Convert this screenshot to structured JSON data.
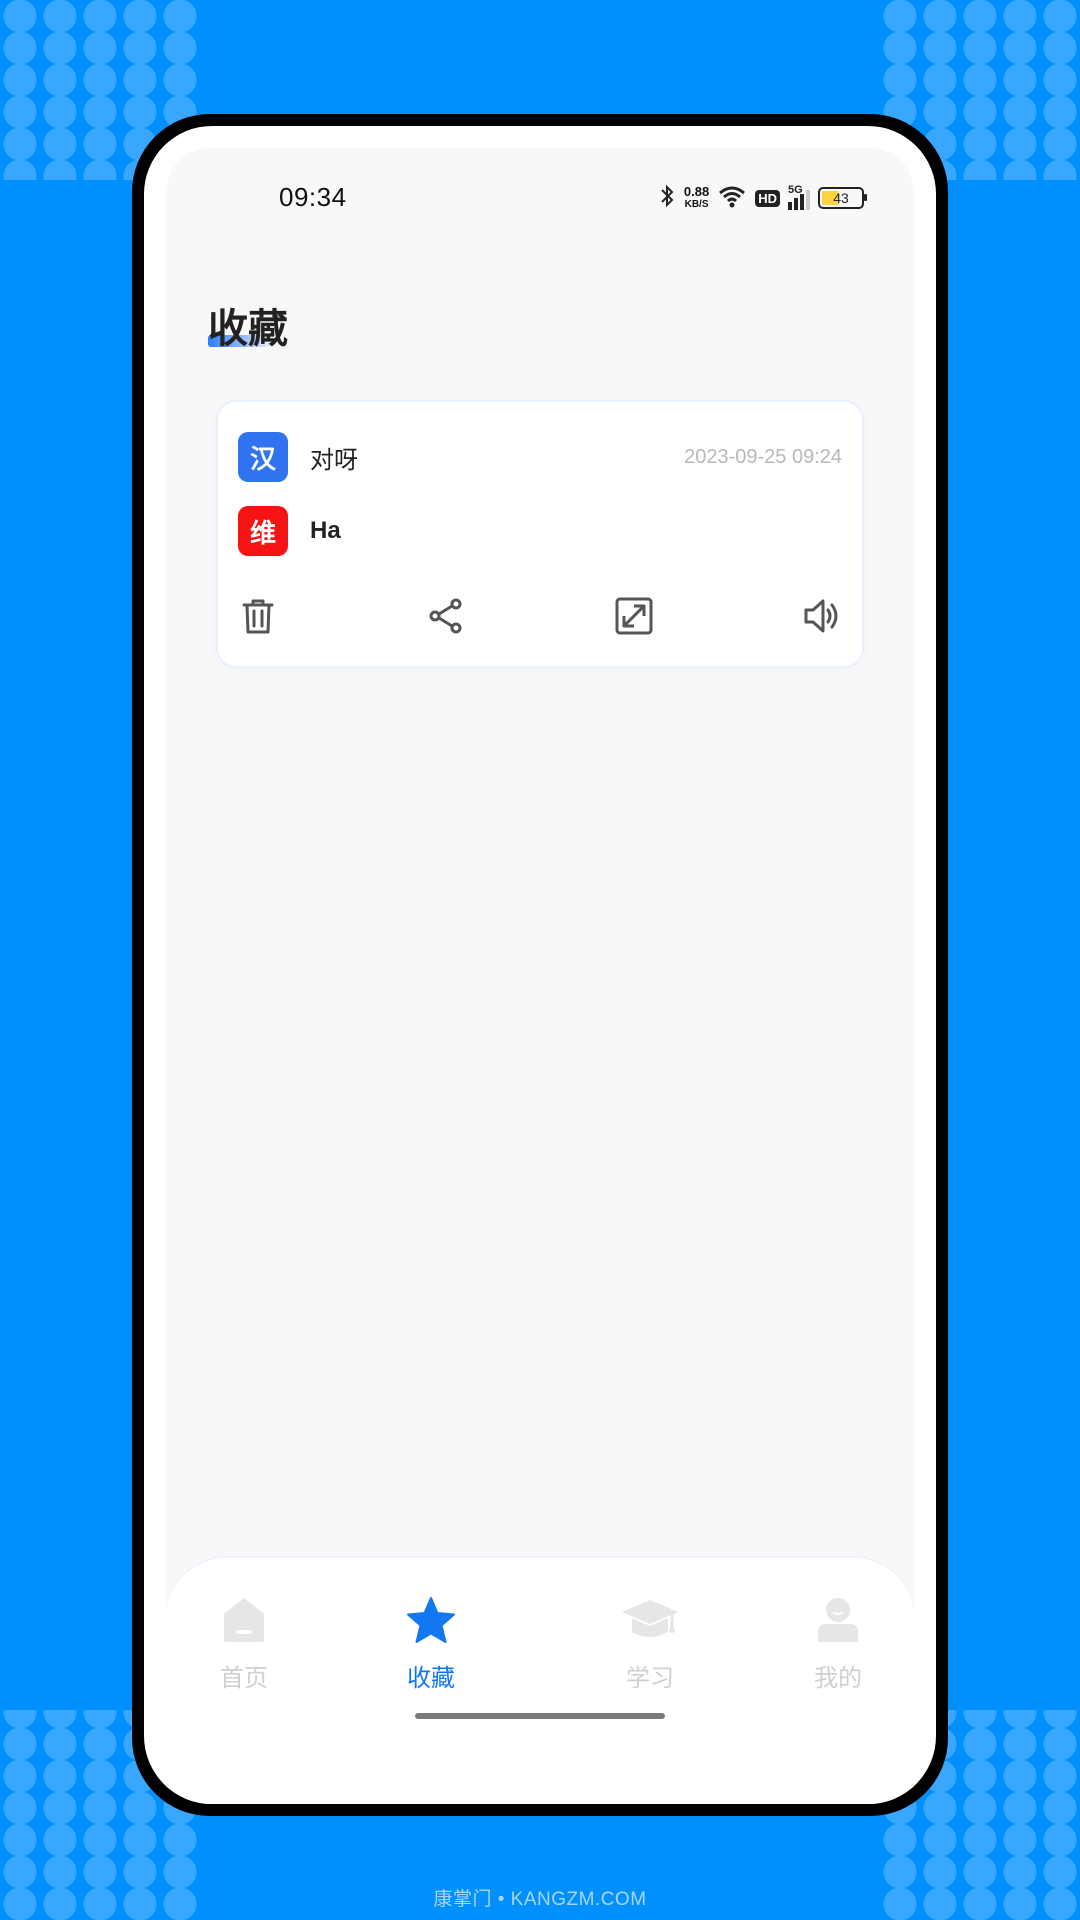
{
  "status_bar": {
    "time": "09:34",
    "net_speed_value": "0.88",
    "net_speed_unit": "KB/S",
    "hd": "HD",
    "network": "5G",
    "battery": "43"
  },
  "page": {
    "title": "收藏"
  },
  "favorites": [
    {
      "source_lang_badge": "汉",
      "source_text": "对呀",
      "timestamp": "2023-09-25 09:24",
      "target_lang_badge": "维",
      "target_text": "Ha"
    }
  ],
  "tabs": [
    {
      "label": "首页",
      "icon": "home-icon",
      "active": false
    },
    {
      "label": "收藏",
      "icon": "star-icon",
      "active": true
    },
    {
      "label": "学习",
      "icon": "graduation-cap-icon",
      "active": false
    },
    {
      "label": "我的",
      "icon": "user-icon",
      "active": false
    }
  ],
  "colors": {
    "background": "#0090fd",
    "accent": "#1278f2",
    "han_badge": "#2f73f0",
    "wei_badge": "#f51313"
  },
  "watermark": "康掌门 • KANGZM.COM"
}
